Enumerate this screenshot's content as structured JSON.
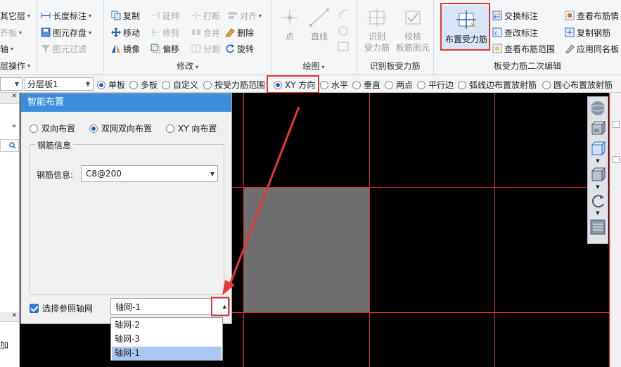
{
  "ribbon": {
    "group1": {
      "title": "",
      "items": [
        "其它层",
        "齐板",
        "轴",
        "层操作"
      ],
      "partial_dims": [
        "则齐板",
        "轴"
      ]
    },
    "group2": {
      "length_mark": "长度标注",
      "save_element": "图元存盘",
      "element_filter": "图元过滤"
    },
    "modify": {
      "title": "修改",
      "copy": "复制",
      "extend": "延伸",
      "break": "打断",
      "align": "对齐",
      "move": "移动",
      "trim": "修剪",
      "merge": "合并",
      "delete": "删除",
      "mirror": "镜像",
      "offset": "偏移",
      "split": "分割",
      "rotate": "旋转"
    },
    "draw": {
      "title": "绘图",
      "point": "点",
      "line": "直线"
    },
    "identify": {
      "title": "识别板受力筋",
      "identify_btn_line1": "识别",
      "identify_btn_line2": "受力筋",
      "verify_btn_line1": "校核",
      "verify_btn_line2": "板筋图元"
    },
    "secondary": {
      "title": "板受力筋二次编辑",
      "place_main_rebar": "布置受力筋",
      "swap_mark": "交换标注",
      "check_mark": "查改标注",
      "view_range": "查看布筋范围",
      "view_info": "查看布筋情",
      "copy_rebar": "复制钢筋",
      "apply_same": "应用同名板"
    }
  },
  "optbar": {
    "combo1": "",
    "combo2": "分层板1",
    "options": [
      {
        "label": "单板",
        "checked": true
      },
      {
        "label": "多板",
        "checked": false
      },
      {
        "label": "自定义",
        "checked": false
      },
      {
        "label": "按受力筋范围",
        "checked": false
      },
      {
        "label": "XY 方向",
        "checked": true
      },
      {
        "label": "水平",
        "checked": false
      },
      {
        "label": "垂直",
        "checked": false
      },
      {
        "label": "两点",
        "checked": false
      },
      {
        "label": "平行边",
        "checked": false
      },
      {
        "label": "弧线边布置放射筋",
        "checked": false
      },
      {
        "label": "圆心布置放射筋",
        "checked": false
      }
    ]
  },
  "leftstrip": {
    "tab_label": "加"
  },
  "dialog": {
    "title": "智能布置",
    "layout_options": [
      {
        "label": "双向布置",
        "checked": false
      },
      {
        "label": "双网双向布置",
        "checked": true
      },
      {
        "label": "XY 向布置",
        "checked": false
      }
    ],
    "rebar_group_legend": "钢筋信息",
    "rebar_label": "钢筋信息:",
    "rebar_value": "C8@200",
    "ref_axis_checkbox": "选择参照轴网",
    "axis_value": "轴网-1",
    "axis_options": [
      "轴网-2",
      "轴网-3",
      "轴网-1"
    ],
    "selected_axis": "轴网-1"
  },
  "colors": {
    "highlight": "#e53935",
    "dialog_title_bg": "#3c8ddc",
    "grid_line": "#e0282c",
    "selected_slab": "#6f6f6f"
  }
}
